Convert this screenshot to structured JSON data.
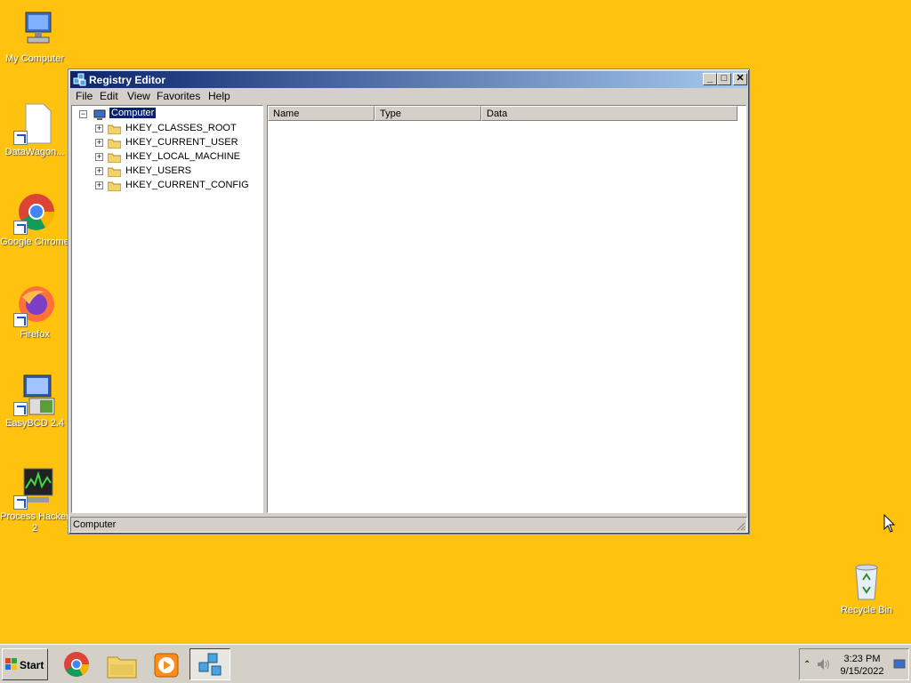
{
  "desktop": {
    "icons": [
      {
        "label": "My Computer",
        "icon": "computer-icon"
      },
      {
        "label": "DataWagon...",
        "icon": "document-icon"
      },
      {
        "label": "Google Chrome",
        "icon": "chrome-icon"
      },
      {
        "label": "Firefox",
        "icon": "firefox-icon"
      },
      {
        "label": "EasyBCD 2.4",
        "icon": "easybcd-icon"
      },
      {
        "label": "Process Hacker 2",
        "icon": "process-hacker-icon"
      },
      {
        "label": "Recycle Bin",
        "icon": "recycle-bin-icon"
      }
    ]
  },
  "window": {
    "title": "Registry Editor",
    "menu": [
      "File",
      "Edit",
      "View",
      "Favorites",
      "Help"
    ],
    "tree": {
      "root": "Computer",
      "children": [
        "HKEY_CLASSES_ROOT",
        "HKEY_CURRENT_USER",
        "HKEY_LOCAL_MACHINE",
        "HKEY_USERS",
        "HKEY_CURRENT_CONFIG"
      ]
    },
    "columns": [
      "Name",
      "Type",
      "Data"
    ],
    "status": "Computer"
  },
  "taskbar": {
    "start_label": "Start",
    "time": "3:23 PM",
    "date": "9/15/2022"
  },
  "colors": {
    "desktop": "#FFC20E",
    "titlebar_start": "#0A246A",
    "titlebar_end": "#A6CAF0",
    "selection": "#0A246A"
  }
}
